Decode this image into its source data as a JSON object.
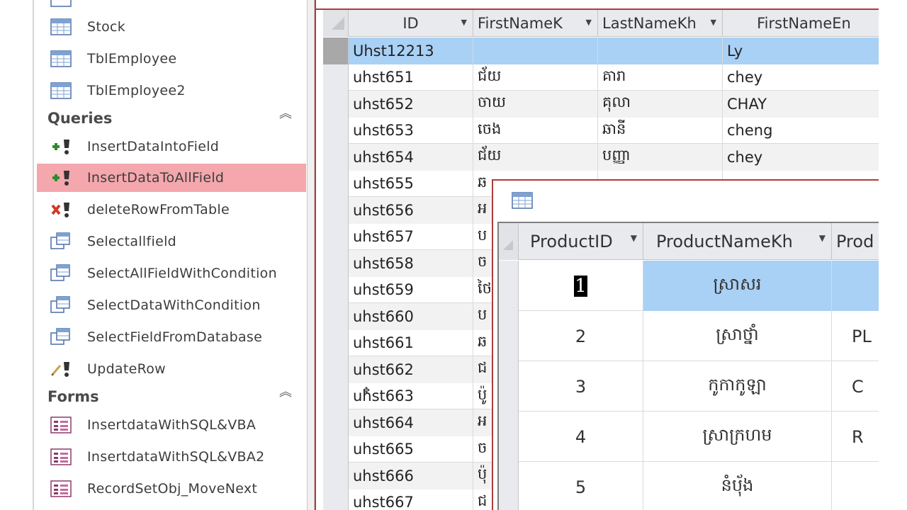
{
  "nav": {
    "tables": [
      {
        "label": "Stock",
        "icon": "table-icon"
      },
      {
        "label": "TblEmployee",
        "icon": "table-icon"
      },
      {
        "label": "TblEmployee2",
        "icon": "table-icon"
      }
    ],
    "queries_title": "Queries",
    "queries": [
      {
        "label": "InsertDataIntoField",
        "icon": "append-query-icon"
      },
      {
        "label": "InsertDataToAllField",
        "icon": "append-query-icon",
        "selected": true
      },
      {
        "label": "deleteRowFromTable",
        "icon": "delete-query-icon"
      },
      {
        "label": "Selectallfield",
        "icon": "select-query-icon"
      },
      {
        "label": "SelectAllFieldWithCondition",
        "icon": "select-query-icon"
      },
      {
        "label": "SelectDataWithCondition",
        "icon": "select-query-icon"
      },
      {
        "label": "SelectFieldFromDatabase",
        "icon": "select-query-icon"
      },
      {
        "label": "UpdateRow",
        "icon": "update-query-icon"
      }
    ],
    "forms_title": "Forms",
    "forms": [
      {
        "label": "InsertdataWithSQL&VBA",
        "icon": "form-icon"
      },
      {
        "label": "InsertdataWithSQL&VBA2",
        "icon": "form-icon"
      },
      {
        "label": "RecordSetObj_MoveNext",
        "icon": "form-icon"
      }
    ],
    "accent_selected": "#f4a7ad"
  },
  "employee_grid": {
    "columns": [
      "ID",
      "FirstNameK",
      "LastNameKh",
      "FirstNameEn"
    ],
    "rows": [
      {
        "id": "Uhst12213",
        "fk": "",
        "lk": "",
        "fe": "Ly"
      },
      {
        "id": "uhst651",
        "fk": "ជ័យ",
        "lk": "គារា",
        "fe": "chey"
      },
      {
        "id": "uhst652",
        "fk": "ចាយ",
        "lk": "គុលា",
        "fe": "CHAY"
      },
      {
        "id": "uhst653",
        "fk": "ចេង",
        "lk": "ឆានី",
        "fe": "cheng"
      },
      {
        "id": "uhst654",
        "fk": "ជ័យ",
        "lk": "បញ្ញា",
        "fe": "chey"
      },
      {
        "id": "uhst655",
        "fk": "ឆ",
        "lk": "",
        "fe": ""
      },
      {
        "id": "uhst656",
        "fk": "អ",
        "lk": "",
        "fe": ""
      },
      {
        "id": "uhst657",
        "fk": "ប",
        "lk": "",
        "fe": ""
      },
      {
        "id": "uhst658",
        "fk": "ច",
        "lk": "",
        "fe": ""
      },
      {
        "id": "uhst659",
        "fk": "ថៃ",
        "lk": "",
        "fe": ""
      },
      {
        "id": "uhst660",
        "fk": "ប",
        "lk": "",
        "fe": ""
      },
      {
        "id": "uhst661",
        "fk": "ឆ",
        "lk": "",
        "fe": ""
      },
      {
        "id": "uhst662",
        "fk": "ជ",
        "lk": "",
        "fe": ""
      },
      {
        "id": "uhst663",
        "fk": "ប៉ូ",
        "lk": "",
        "fe": ""
      },
      {
        "id": "uhst664",
        "fk": "អ",
        "lk": "",
        "fe": ""
      },
      {
        "id": "uhst665",
        "fk": "ច",
        "lk": "",
        "fe": ""
      },
      {
        "id": "uhst666",
        "fk": "ប៉ុ",
        "lk": "",
        "fe": ""
      },
      {
        "id": "uhst667",
        "fk": "ជ",
        "lk": "",
        "fe": ""
      }
    ]
  },
  "product_grid": {
    "columns": [
      "ProductID",
      "ProductNameKh",
      "Prod"
    ],
    "rows": [
      {
        "id": "1",
        "name": "ស្រាសរ",
        "extra": ""
      },
      {
        "id": "2",
        "name": "ស្រាថ្នាំ",
        "extra": "PL"
      },
      {
        "id": "3",
        "name": "កូកាកូឡា",
        "extra": "C"
      },
      {
        "id": "4",
        "name": "ស្រាក្រហម",
        "extra": "R"
      },
      {
        "id": "5",
        "name": "នំប៉័ង",
        "extra": ""
      }
    ]
  }
}
